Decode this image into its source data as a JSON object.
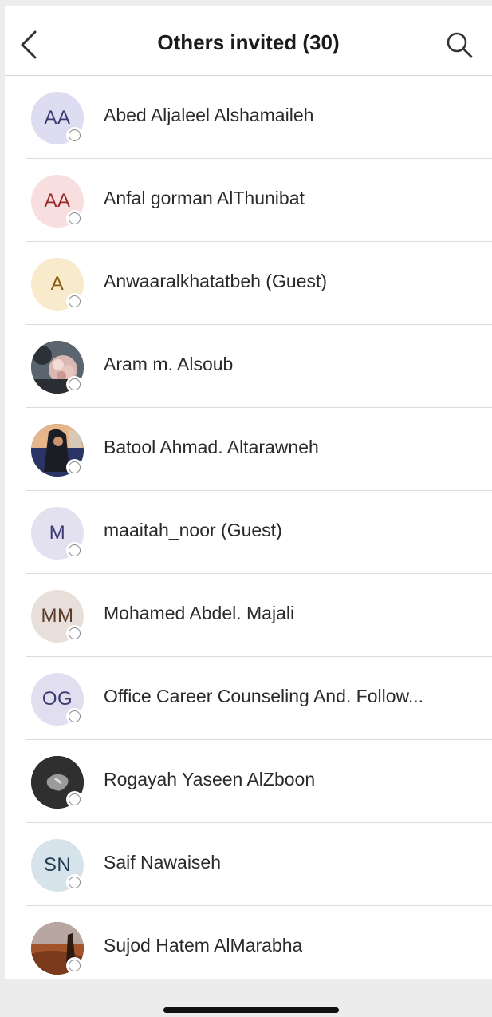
{
  "header": {
    "title": "Others invited (30)",
    "back_icon": "chevron-left-icon",
    "search_icon": "search-icon"
  },
  "people": [
    {
      "name": "Abed Aljaleel Alshamaileh",
      "initials": "AA",
      "avatar_bg": "#dedcf0",
      "initials_color": "#3d3a73"
    },
    {
      "name": "Anfal gorman AlThunibat",
      "initials": "AA",
      "avatar_bg": "#f8dede",
      "initials_color": "#9a2b2b"
    },
    {
      "name": "Anwaaralkhatatbeh (Guest)",
      "initials": "A",
      "avatar_bg": "#f8ebcc",
      "initials_color": "#8a5a10"
    },
    {
      "name": "Aram m. Alsoub",
      "initials": "",
      "avatar_bg": "#3a3f44",
      "initials_color": "#ffffff"
    },
    {
      "name": "Batool Ahmad. Altarawneh",
      "initials": "",
      "avatar_bg": "#2c2e5c",
      "initials_color": "#ffffff"
    },
    {
      "name": "maaitah_noor (Guest)",
      "initials": "M",
      "avatar_bg": "#e3e0f0",
      "initials_color": "#3d3a73"
    },
    {
      "name": "Mohamed Abdel. Majali",
      "initials": "MM",
      "avatar_bg": "#e9dfda",
      "initials_color": "#5a3b2e"
    },
    {
      "name": "Office Career Counseling And. Follow...",
      "initials": "OG",
      "avatar_bg": "#e1def0",
      "initials_color": "#3d3a73"
    },
    {
      "name": "Rogayah Yaseen AlZboon",
      "initials": "",
      "avatar_bg": "#3b3b3b",
      "initials_color": "#ffffff"
    },
    {
      "name": "Saif Nawaiseh",
      "initials": "SN",
      "avatar_bg": "#d7e3ea",
      "initials_color": "#1f3d55"
    },
    {
      "name": "Sujod Hatem AlMarabha",
      "initials": "",
      "avatar_bg": "#6b4a3a",
      "initials_color": "#ffffff"
    }
  ]
}
